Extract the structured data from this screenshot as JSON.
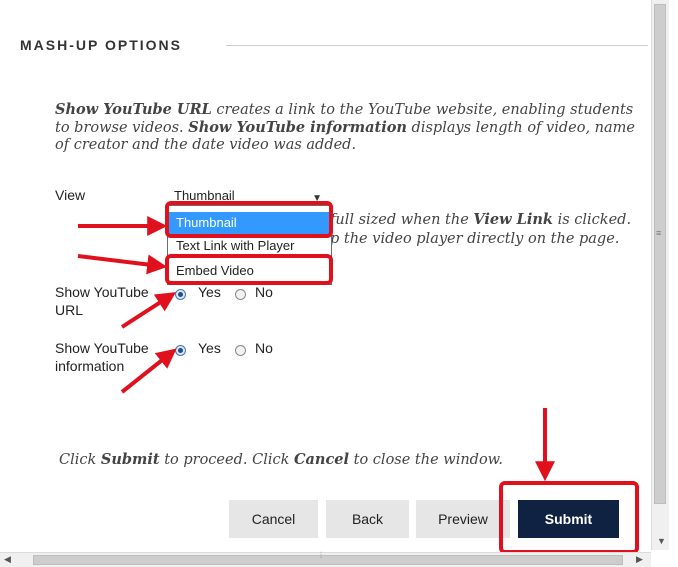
{
  "section": {
    "title": "MASH-UP OPTIONS"
  },
  "intro": {
    "b1": "Show YouTube URL",
    "t1": " creates a link to the YouTube website, enabling students to browse videos. ",
    "b2": "Show YouTube information",
    "t2": " displays length of video, name of creator and the date video was added."
  },
  "view": {
    "label": "View",
    "selected": "Thumbnail",
    "options": [
      "Thumbnail",
      "Text Link with Player",
      "Embed Video"
    ],
    "hint1_a": "full sized when the ",
    "hint1_b": "View Link",
    "hint1_c": " is clicked.",
    "hint2": "p the video player directly on the page."
  },
  "show_url": {
    "label_line1": "Show YouTube",
    "label_line2": "URL",
    "yes": "Yes",
    "no": "No",
    "value": "Yes"
  },
  "show_info": {
    "label_line1": "Show YouTube",
    "label_line2": "information",
    "yes": "Yes",
    "no": "No",
    "value": "Yes"
  },
  "footer": {
    "t1": "Click ",
    "b1": "Submit",
    "t2": " to proceed. Click ",
    "b2": "Cancel",
    "t3": " to close the window."
  },
  "buttons": {
    "cancel": "Cancel",
    "back": "Back",
    "preview": "Preview",
    "submit": "Submit"
  },
  "icons": {
    "dropdown": "chevron-down-icon",
    "scroll_grip": "grip-icon"
  },
  "colors": {
    "highlight": "#e0101d",
    "submit_bg": "#0f2242",
    "option_selected": "#3399ff"
  }
}
